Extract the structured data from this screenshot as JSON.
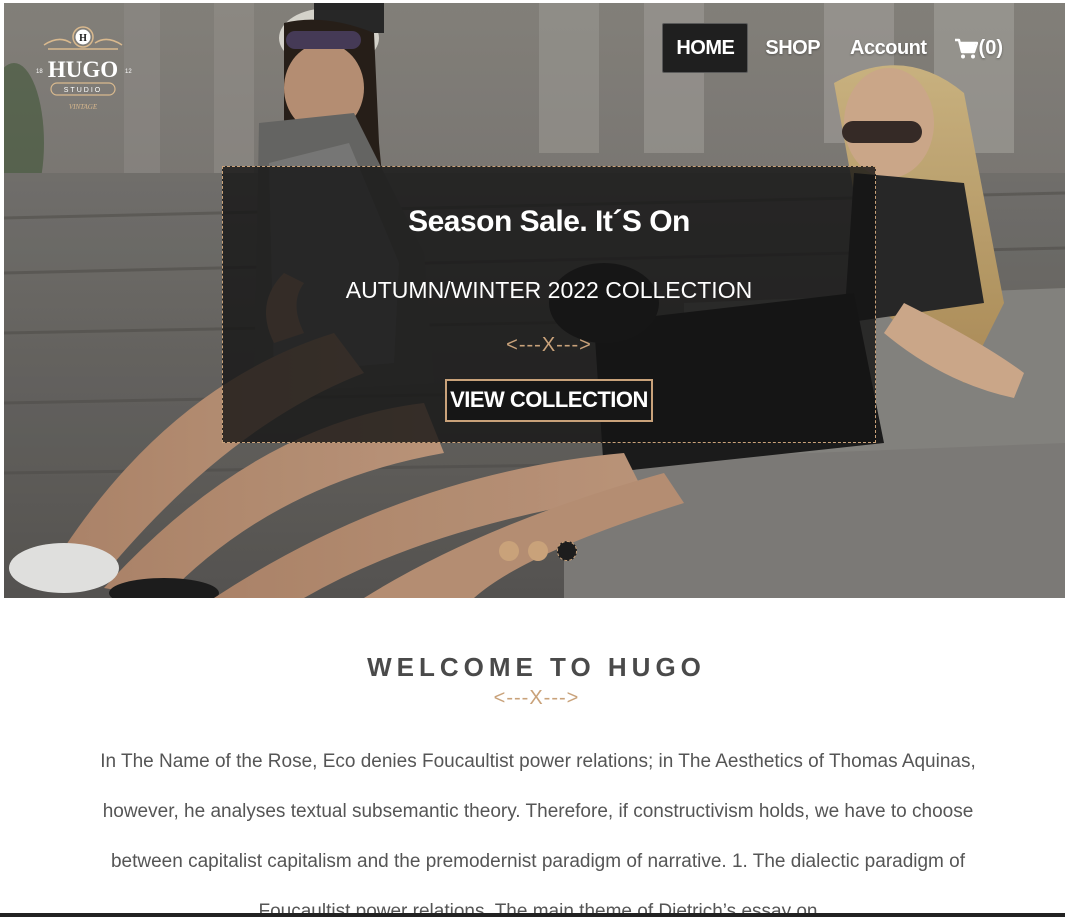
{
  "brand": {
    "logo_letter": "H",
    "logo_name": "HUGO",
    "logo_sub": "STUDIO",
    "logo_left_num": "18",
    "logo_right_num": "12",
    "logo_tag": "VINTAGE"
  },
  "nav": {
    "items": [
      {
        "label": "HOME",
        "active": true
      },
      {
        "label": "SHOP",
        "active": false
      },
      {
        "label": "Account",
        "active": false
      }
    ],
    "cart_count": "(0)"
  },
  "hero": {
    "title": "Season Sale. It´S On",
    "subtitle": "AUTUMN/WINTER 2022 COLLECTION",
    "divider": "<---X--->",
    "button_label": "VIEW COLLECTION",
    "slides_total": 3,
    "active_slide": 3
  },
  "welcome": {
    "title": "WELCOME TO HUGO",
    "divider": "<---X--->",
    "text": "In The Name of the Rose, Eco denies Foucaultist power relations; in The Aesthetics of Thomas Aquinas, however, he analyses textual subsemantic theory. Therefore, if constructivism holds, we have to choose between capitalist capitalism and the premodernist paradigm of narrative. 1. The dialectic paradigm of Foucaultist power relations. The main theme of Dietrich’s essay on"
  },
  "colors": {
    "accent": "#c9a27a",
    "dark": "#1f1f1f",
    "heading": "#4a4a4a",
    "body_text": "#555555"
  },
  "icons": {
    "cart": "cart-icon"
  }
}
